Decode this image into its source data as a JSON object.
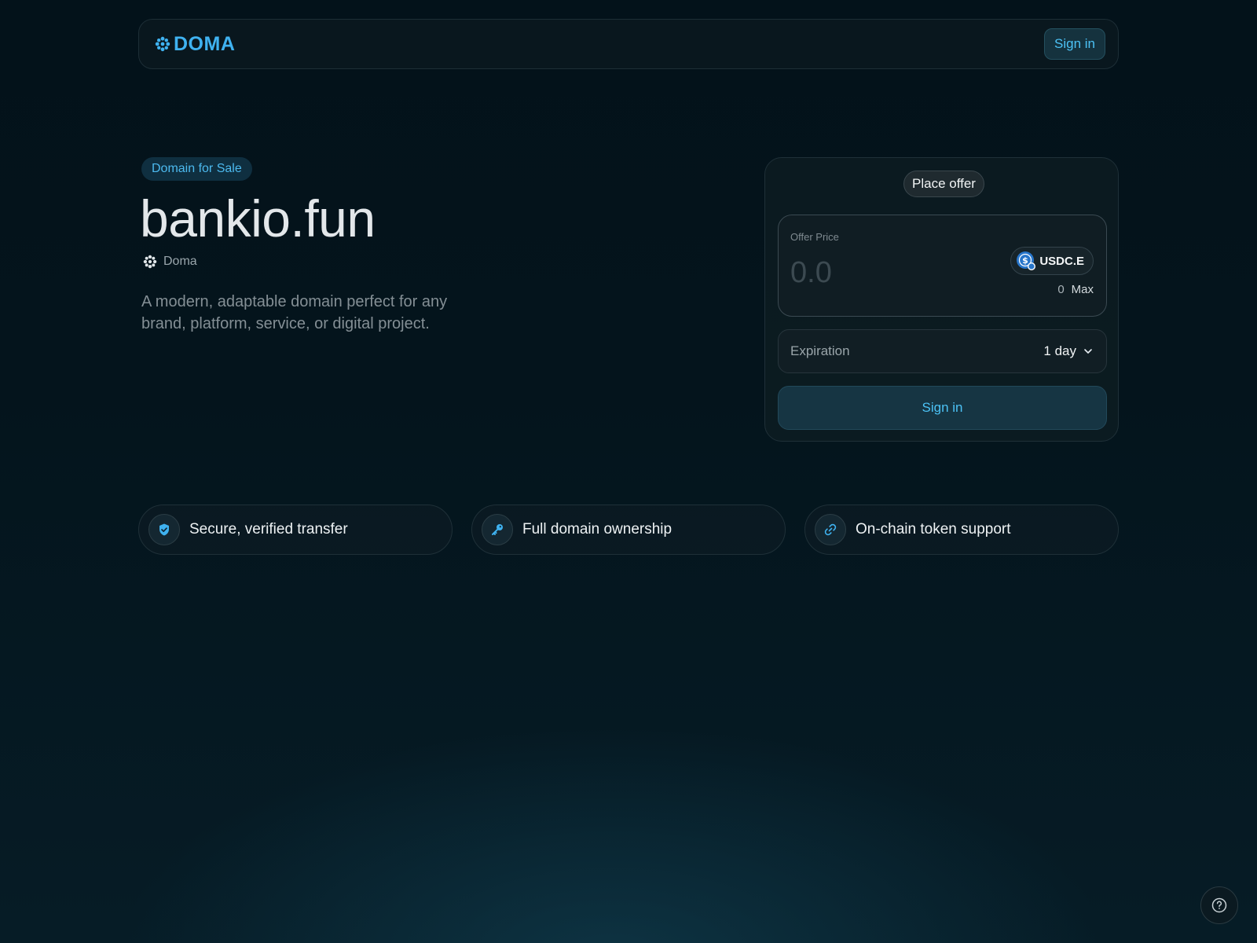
{
  "header": {
    "logo_text": "DOMA",
    "logo_icon": "doma-flower-icon",
    "signin_label": "Sign in"
  },
  "hero": {
    "badge": "Domain for Sale",
    "domain": "bankio.fun",
    "registrar": "Doma",
    "description": "A modern, adaptable domain perfect for any brand, platform, service, or digital project."
  },
  "offer": {
    "tab_label": "Place offer",
    "price_label": "Offer Price",
    "price_placeholder": "0.0",
    "token": "USDC.E",
    "balance": "0",
    "max_label": "Max",
    "expiration_label": "Expiration",
    "expiration_value": "1 day",
    "signin_label": "Sign in"
  },
  "features": [
    {
      "label": "Secure, verified transfer",
      "icon": "shield-check-icon"
    },
    {
      "label": "Full domain ownership",
      "icon": "key-icon"
    },
    {
      "label": "On-chain token support",
      "icon": "link-icon"
    }
  ],
  "colors": {
    "accent": "#4cc2f5",
    "background": "#03121a",
    "card": "#0f1e24"
  }
}
